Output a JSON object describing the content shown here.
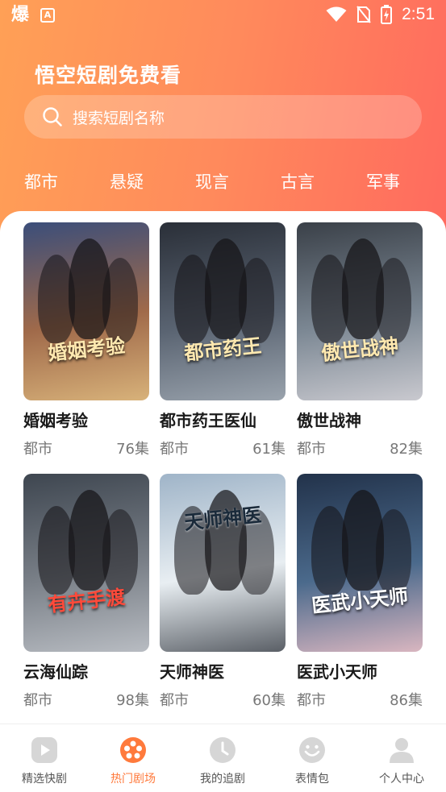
{
  "status_bar": {
    "app_glyph": "爆",
    "small_icon": "A",
    "time": "2:51"
  },
  "header": {
    "title": "悟空短剧免费看",
    "search_placeholder": "搜索短剧名称"
  },
  "categories": [
    "都市",
    "悬疑",
    "现言",
    "古言",
    "军事"
  ],
  "dramas": [
    {
      "name": "婚姻考验",
      "poster_text": "婚姻考验",
      "genre": "都市",
      "episodes": "76集",
      "colors": [
        "#3b4e7a",
        "#a06a4a",
        "#d8b27a"
      ]
    },
    {
      "name": "都市药王医仙",
      "poster_text": "都市药王",
      "genre": "都市",
      "episodes": "61集",
      "colors": [
        "#2a2f38",
        "#5a6472",
        "#9aa3ad"
      ]
    },
    {
      "name": "傲世战神",
      "poster_text": "傲世战神",
      "genre": "都市",
      "episodes": "82集",
      "colors": [
        "#3a4048",
        "#7c8894",
        "#c9c9cf"
      ]
    },
    {
      "name": "云海仙踪",
      "poster_text": "有卉手渡",
      "genre": "都市",
      "episodes": "98集",
      "colors": [
        "#3e4650",
        "#7a8088",
        "#b8bcc2"
      ]
    },
    {
      "name": "天师神医",
      "poster_text": "天师神医",
      "genre": "都市",
      "episodes": "60集",
      "colors": [
        "#9fb4c8",
        "#e8eef2",
        "#5a5f66"
      ]
    },
    {
      "name": "医武小天师",
      "poster_text": "医武小天师",
      "genre": "都市",
      "episodes": "86集",
      "colors": [
        "#22324a",
        "#4b6a8c",
        "#d9b6c0"
      ]
    }
  ],
  "tabbar": [
    {
      "label": "精选快剧",
      "icon": "play-icon",
      "active": false
    },
    {
      "label": "热门剧场",
      "icon": "film-reel-icon",
      "active": true
    },
    {
      "label": "我的追剧",
      "icon": "clock-icon",
      "active": false
    },
    {
      "label": "表情包",
      "icon": "smiley-icon",
      "active": false
    },
    {
      "label": "个人中心",
      "icon": "person-icon",
      "active": false
    }
  ],
  "colors": {
    "accent": "#ff7a3c",
    "header_start": "#ffa056",
    "header_end": "#ff6a5e",
    "tab_inactive": "#d6d6d6"
  }
}
